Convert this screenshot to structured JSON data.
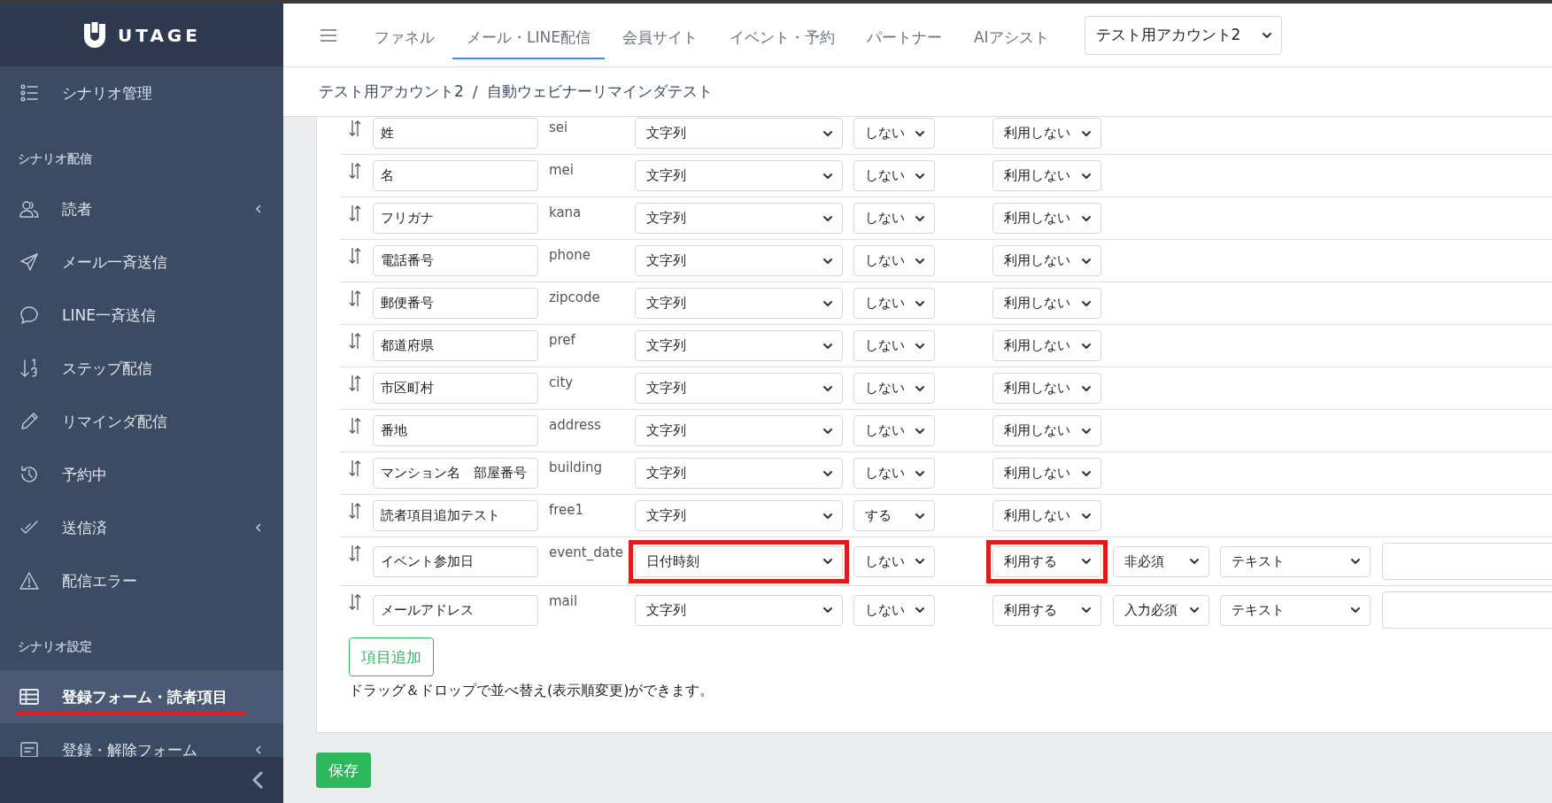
{
  "sidebar": {
    "logo_text": "UTAGE",
    "items": [
      {
        "kind": "item",
        "label": "シナリオ管理",
        "selected": false,
        "has_caret": false,
        "underlined": false
      },
      {
        "kind": "section",
        "label": "シナリオ配信",
        "selected": false,
        "has_caret": false,
        "underlined": false
      },
      {
        "kind": "item",
        "label": "読者",
        "selected": false,
        "has_caret": true,
        "underlined": false
      },
      {
        "kind": "item",
        "label": "メール一斉送信",
        "selected": false,
        "has_caret": false,
        "underlined": false
      },
      {
        "kind": "item",
        "label": "LINE一斉送信",
        "selected": false,
        "has_caret": false,
        "underlined": false
      },
      {
        "kind": "item",
        "label": "ステップ配信",
        "selected": false,
        "has_caret": false,
        "underlined": false
      },
      {
        "kind": "item",
        "label": "リマインダ配信",
        "selected": false,
        "has_caret": false,
        "underlined": false
      },
      {
        "kind": "item",
        "label": "予約中",
        "selected": false,
        "has_caret": false,
        "underlined": false
      },
      {
        "kind": "item",
        "label": "送信済",
        "selected": false,
        "has_caret": true,
        "underlined": false
      },
      {
        "kind": "item",
        "label": "配信エラー",
        "selected": false,
        "has_caret": false,
        "underlined": false
      },
      {
        "kind": "section",
        "label": "シナリオ設定",
        "selected": false,
        "has_caret": false,
        "underlined": false
      },
      {
        "kind": "item",
        "label": "登録フォーム・読者項目",
        "selected": true,
        "has_caret": false,
        "underlined": true
      },
      {
        "kind": "item",
        "label": "登録・解除フォーム",
        "selected": false,
        "has_caret": true,
        "underlined": false
      }
    ]
  },
  "nav": {
    "tabs": [
      {
        "label": "ファネル",
        "selected": false
      },
      {
        "label": "メール・LINE配信",
        "selected": true
      },
      {
        "label": "会員サイト",
        "selected": false
      },
      {
        "label": "イベント・予約",
        "selected": false
      },
      {
        "label": "パートナー",
        "selected": false
      },
      {
        "label": "AIアシスト",
        "selected": false
      }
    ],
    "account_select": "テスト用アカウント2"
  },
  "breadcrumb": {
    "items": [
      "テスト用アカウント2",
      "自動ウェビナーリマインダテスト"
    ],
    "separator": "/"
  },
  "fields": [
    {
      "name": "姓",
      "key": "sei",
      "type": "文字列",
      "type_highlighted": false,
      "column_4": "しない",
      "usage": "利用しない",
      "usage_highlighted": false
    },
    {
      "name": "名",
      "key": "mei",
      "type": "文字列",
      "type_highlighted": false,
      "column_4": "しない",
      "usage": "利用しない",
      "usage_highlighted": false
    },
    {
      "name": "フリガナ",
      "key": "kana",
      "type": "文字列",
      "type_highlighted": false,
      "column_4": "しない",
      "usage": "利用しない",
      "usage_highlighted": false
    },
    {
      "name": "電話番号",
      "key": "phone",
      "type": "文字列",
      "type_highlighted": false,
      "column_4": "しない",
      "usage": "利用しない",
      "usage_highlighted": false
    },
    {
      "name": "郵便番号",
      "key": "zipcode",
      "type": "文字列",
      "type_highlighted": false,
      "column_4": "しない",
      "usage": "利用しない",
      "usage_highlighted": false
    },
    {
      "name": "都道府県",
      "key": "pref",
      "type": "文字列",
      "type_highlighted": false,
      "column_4": "しない",
      "usage": "利用しない",
      "usage_highlighted": false
    },
    {
      "name": "市区町村",
      "key": "city",
      "type": "文字列",
      "type_highlighted": false,
      "column_4": "しない",
      "usage": "利用しない",
      "usage_highlighted": false
    },
    {
      "name": "番地",
      "key": "address",
      "type": "文字列",
      "type_highlighted": false,
      "column_4": "しない",
      "usage": "利用しない",
      "usage_highlighted": false
    },
    {
      "name": "マンション名　部屋番号",
      "key": "building",
      "type": "文字列",
      "type_highlighted": false,
      "column_4": "しない",
      "usage": "利用しない",
      "usage_highlighted": false
    },
    {
      "name": "読者項目追加テスト",
      "key": "free1",
      "type": "文字列",
      "type_highlighted": false,
      "column_4": "する",
      "usage": "利用しない",
      "usage_highlighted": false
    },
    {
      "name": "イベント参加日",
      "key": "event_date",
      "type": "日付時刻",
      "type_highlighted": true,
      "column_4": "しない",
      "usage": "利用する",
      "usage_highlighted": true,
      "requirement": "非必須",
      "input_type": "テキスト",
      "extra_field": true
    },
    {
      "name": "メールアドレス",
      "key": "mail",
      "type": "文字列",
      "type_highlighted": false,
      "column_4": "しない",
      "usage": "利用する",
      "usage_highlighted": false,
      "requirement": "入力必須",
      "input_type": "テキスト",
      "extra_field": true
    }
  ],
  "add_button": "項目追加",
  "hint": "ドラッグ＆ドロップで並べ替え(表示順変更)ができます。",
  "save_button": "保存"
}
